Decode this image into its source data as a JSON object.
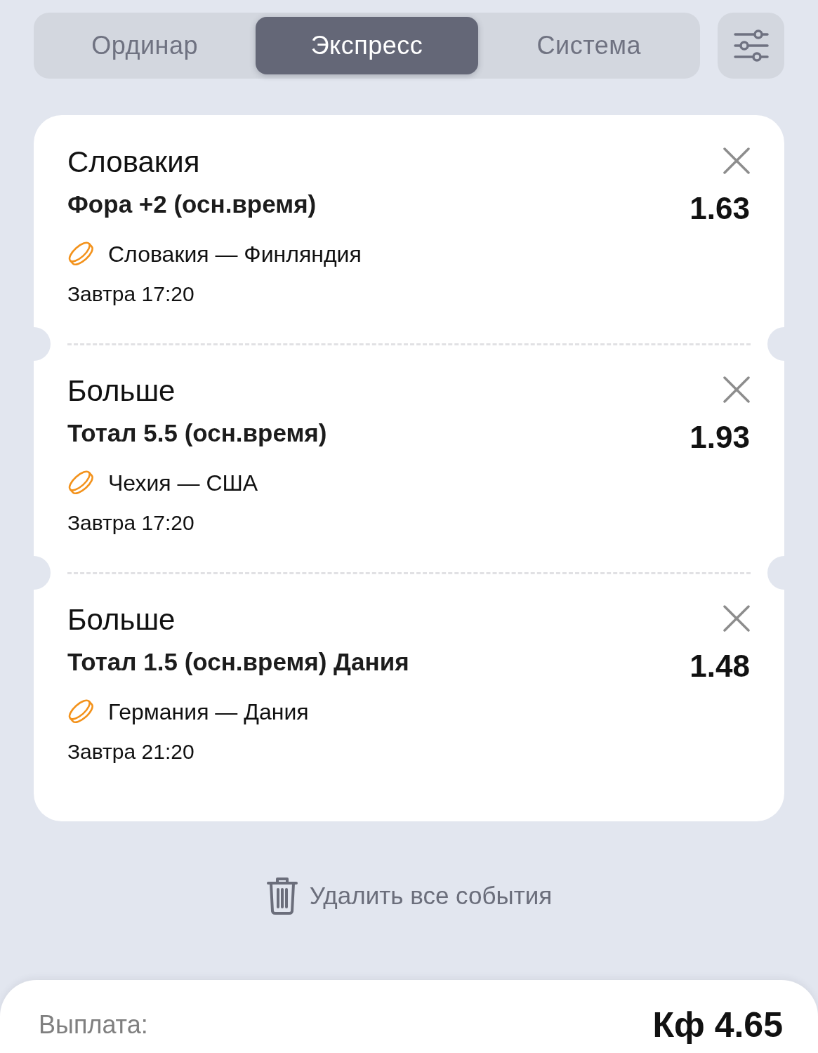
{
  "tabs": [
    {
      "label": "Ординар",
      "selected": false
    },
    {
      "label": "Экспресс",
      "selected": true
    },
    {
      "label": "Система",
      "selected": false
    }
  ],
  "events": [
    {
      "selection": "Словакия",
      "market": "Фора +2 (осн.время)",
      "odds": "1.63",
      "match": "Словакия — Финляндия",
      "time": "Завтра 17:20"
    },
    {
      "selection": "Больше",
      "market": "Тотал 5.5 (осн.время)",
      "odds": "1.93",
      "match": "Чехия — США",
      "time": "Завтра 17:20"
    },
    {
      "selection": "Больше",
      "market": "Тотал 1.5 (осн.время) Дания",
      "odds": "1.48",
      "match": "Германия — Дания",
      "time": "Завтра 21:20"
    }
  ],
  "delete_all": {
    "label": "Удалить все события"
  },
  "payout": {
    "label": "Выплата:",
    "coefficient": "Кф 4.65"
  }
}
